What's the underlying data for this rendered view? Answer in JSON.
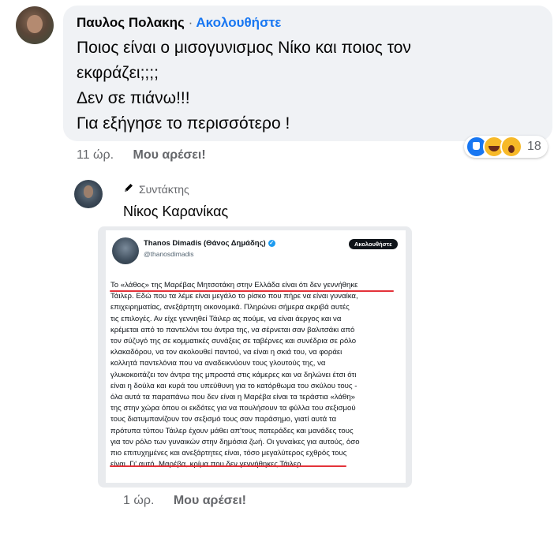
{
  "comment": {
    "author": "Παυλος Πολακης",
    "separator": "·",
    "follow_label": "Ακολουθήστε",
    "lines": [
      "Ποιος είναι ο μισογυνισμος Νίκο και ποιος τον",
      "εκφράζει;;;;",
      "Δεν σε πιάνω!!!",
      "Για εξήγησε το περισσότερο !"
    ],
    "reactions": {
      "icons": [
        "like-icon",
        "haha-icon",
        "wow-icon"
      ],
      "count": "18"
    },
    "time": "11 ώρ.",
    "like_label": "Μου αρέσει!"
  },
  "reply": {
    "role": "Συντάκτης",
    "role_icon": "pencil-icon",
    "author": "Νίκος Καρανίκας",
    "time": "1 ώρ.",
    "like_label": "Μου αρέσει!"
  },
  "tweet": {
    "name": "Thanos Dimadis (Θάνος Δημάδης)",
    "verified_icon": "verified-icon",
    "handle": "@thanosdimadis",
    "follow_label": "Ακολουθήστε",
    "lines": [
      "Το «λάθος» της Μαρέβας Μητσοτάκη στην Ελλάδα είναι ότι δεν γεννήθηκε",
      "Τάιλερ. Εδώ που τα λέμε είναι μεγάλο το ρίσκο που πήρε να είναι γυναίκα,",
      "επιχειρηματίας, ανεξάρτητη οικονομικά. Πληρώνει σήμερα ακριβά αυτές",
      "τις επιλογές. Αν είχε γεννηθεί Τάιλερ ας πούμε, να είναι άεργος και να",
      "κρέμεται από το παντελόνι του άντρα της, να σέρνεται σαν βαλιτσάκι από",
      "τον σύζυγό της σε κομματικές συνάξεις σε ταβέρνες και συνέδρια σε ρόλο",
      "κλακαδόρου, να τον ακολουθεί παντού, να είναι η σκιά του, να φοράει",
      "κολλητά παντελόνια που να αναδεικνύουν τους γλουτούς της, να",
      "γλυκοκοιτάζει τον άντρα της μπροστά στις κάμερες και να δηλώνει έτσι ότι",
      "είναι η δούλα και κυρά του υπεύθυνη για το κατόρθωμα του σκύλου τους -",
      "όλα αυτά τα παραπάνω που δεν είναι η Μαρέβα είναι τα τεράστια «λάθη»",
      "της στην χώρα όπου οι εκδότες για να πουλήσουν τα φύλλα του σεξισμού",
      "τους διατυμπανίζουν τον σεξισμό τους σαν παράσημο, γιατί αυτά τα",
      "πρότυπα τύπου Τάιλερ έχουν μάθει απ'τους πατεράδες και μανάδες τους",
      "για τον ρόλο των γυναικών στην δημόσια ζωή. Οι γυναίκες για αυτούς, όσο",
      "πιο επιτυχημένες και ανεξάρτητες είναι, τόσο μεγαλύτερος εχθρός τους",
      "είναι. Γι' αυτό, Μαρέβα, κρίμα που δεν γεννήθηκες Τάιλερ."
    ]
  }
}
